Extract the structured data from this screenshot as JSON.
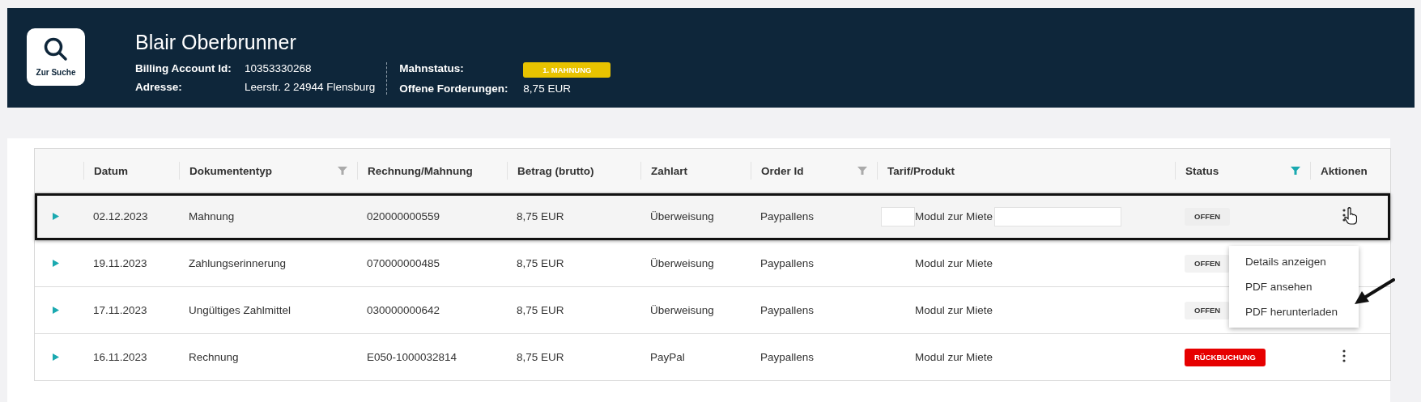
{
  "header": {
    "search_button": "Zur Suche",
    "customer_name": "Blair Oberbrunner",
    "details_left": [
      {
        "label": "Billing Account Id:",
        "value": "10353330268"
      },
      {
        "label": "Adresse:",
        "value": "Leerstr. 2 24944 Flensburg"
      }
    ],
    "dunning_label": "Mahnstatus:",
    "dunning_badge": "1. MAHNUNG",
    "open_label": "Offene Forderungen:",
    "open_value": "8,75 EUR"
  },
  "table": {
    "columns": [
      {
        "label": "Datum"
      },
      {
        "label": "Dokumententyp",
        "filter_active": false
      },
      {
        "label": "Rechnung/Mahnung"
      },
      {
        "label": "Betrag (brutto)"
      },
      {
        "label": "Zahlart"
      },
      {
        "label": "Order Id",
        "filter_active": false
      },
      {
        "label": "Tarif/Produkt"
      },
      {
        "label": "Status",
        "filter_active": true
      },
      {
        "label": "Aktionen"
      }
    ],
    "rows": [
      {
        "selected": true,
        "date": "02.12.2023",
        "type": "Mahnung",
        "number": "020000000559",
        "amount": "8,75 EUR",
        "payment": "Überweisung",
        "order_id": "Paypallens",
        "product": "Modul zur Miete",
        "product_redacted": true,
        "status": "OFFEN",
        "color": "#eeeeee"
      },
      {
        "selected": false,
        "date": "19.11.2023",
        "type": "Zahlungserinnerung",
        "number": "070000000485",
        "amount": "8,75 EUR",
        "payment": "Überweisung",
        "order_id": "Paypallens",
        "product": "Modul zur Miete",
        "product_redacted": false,
        "status": "OFFEN",
        "color": "#f2f2f2"
      },
      {
        "selected": false,
        "date": "17.11.2023",
        "type": "Ungültiges Zahlmittel",
        "number": "030000000642",
        "amount": "8,75 EUR",
        "payment": "Überweisung",
        "order_id": "Paypallens",
        "product": "Modul zur Miete",
        "product_redacted": false,
        "status": "OFFEN",
        "color": "#f2f2f2"
      },
      {
        "selected": false,
        "date": "16.11.2023",
        "type": "Rechnung",
        "number": "E050-1000032814",
        "amount": "8,75 EUR",
        "payment": "PayPal",
        "order_id": "Paypallens",
        "product": "Modul zur Miete",
        "product_redacted": false,
        "status": "RÜCKBUCHUNG",
        "color": "#e60000"
      }
    ],
    "actions_menu": [
      "Details anzeigen",
      "PDF ansehen",
      "PDF herunterladen"
    ]
  }
}
